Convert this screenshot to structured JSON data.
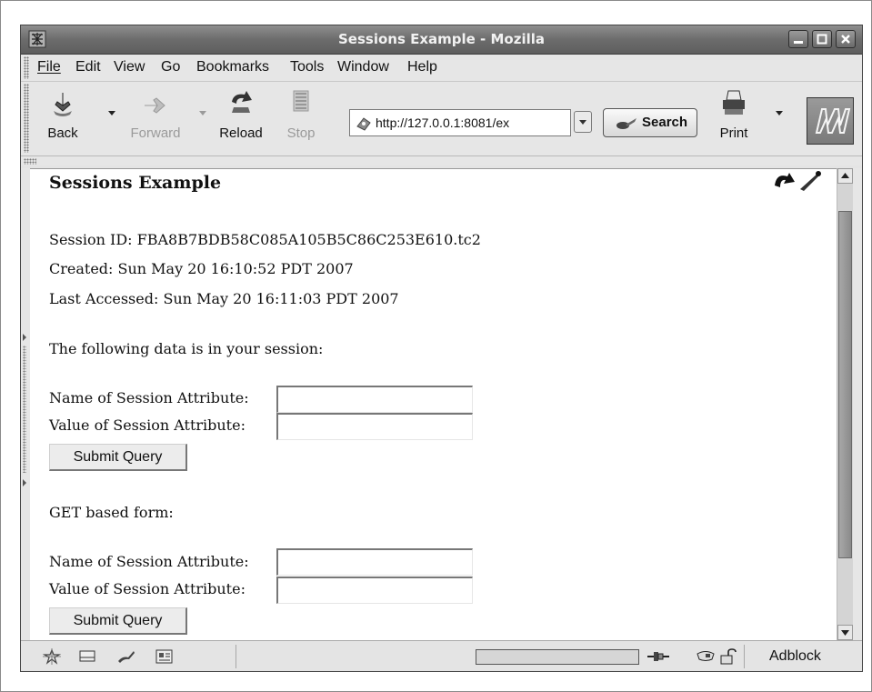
{
  "window": {
    "title": "Sessions Example - Mozilla"
  },
  "menubar": {
    "items": [
      "File",
      "Edit",
      "View",
      "Go",
      "Bookmarks",
      "Tools",
      "Window",
      "Help"
    ]
  },
  "toolbar": {
    "back_label": "Back",
    "forward_label": "Forward",
    "reload_label": "Reload",
    "stop_label": "Stop",
    "url_value": "http://127.0.0.1:8081/ex",
    "search_label": "Search",
    "print_label": "Print"
  },
  "page": {
    "heading": "Sessions Example",
    "session_id": "Session ID: FBA8B7BDB58C085A105B5C86C253E610.tc2",
    "created": "Created: Sun May 20 16:10:52 PDT 2007",
    "last_accessed": "Last Accessed: Sun May 20 16:11:03 PDT 2007",
    "data_intro": "The following data is in your session:",
    "post_form": {
      "name_label": "Name of Session Attribute:",
      "name_value": "",
      "value_label": "Value of Session Attribute:",
      "value_value": "",
      "submit_label": "Submit Query"
    },
    "get_heading": "GET based form:",
    "get_form": {
      "name_label": "Name of Session Attribute:",
      "name_value": "",
      "value_label": "Value of Session Attribute:",
      "value_value": "",
      "submit_label": "Submit Query"
    }
  },
  "scrollbar": {
    "thumb_position_fraction": 0.0,
    "thumb_size_fraction": 0.85
  },
  "statusbar": {
    "text": "Adblock",
    "progress_fraction": 0.0
  },
  "icons": {
    "app": "mozilla-app-icon",
    "back": "back-arrow-icon",
    "forward": "forward-arrow-icon",
    "reload": "reload-icon",
    "stop": "stop-icon",
    "search": "search-icon",
    "print": "print-icon",
    "throbber": "mozilla-m-logo"
  }
}
